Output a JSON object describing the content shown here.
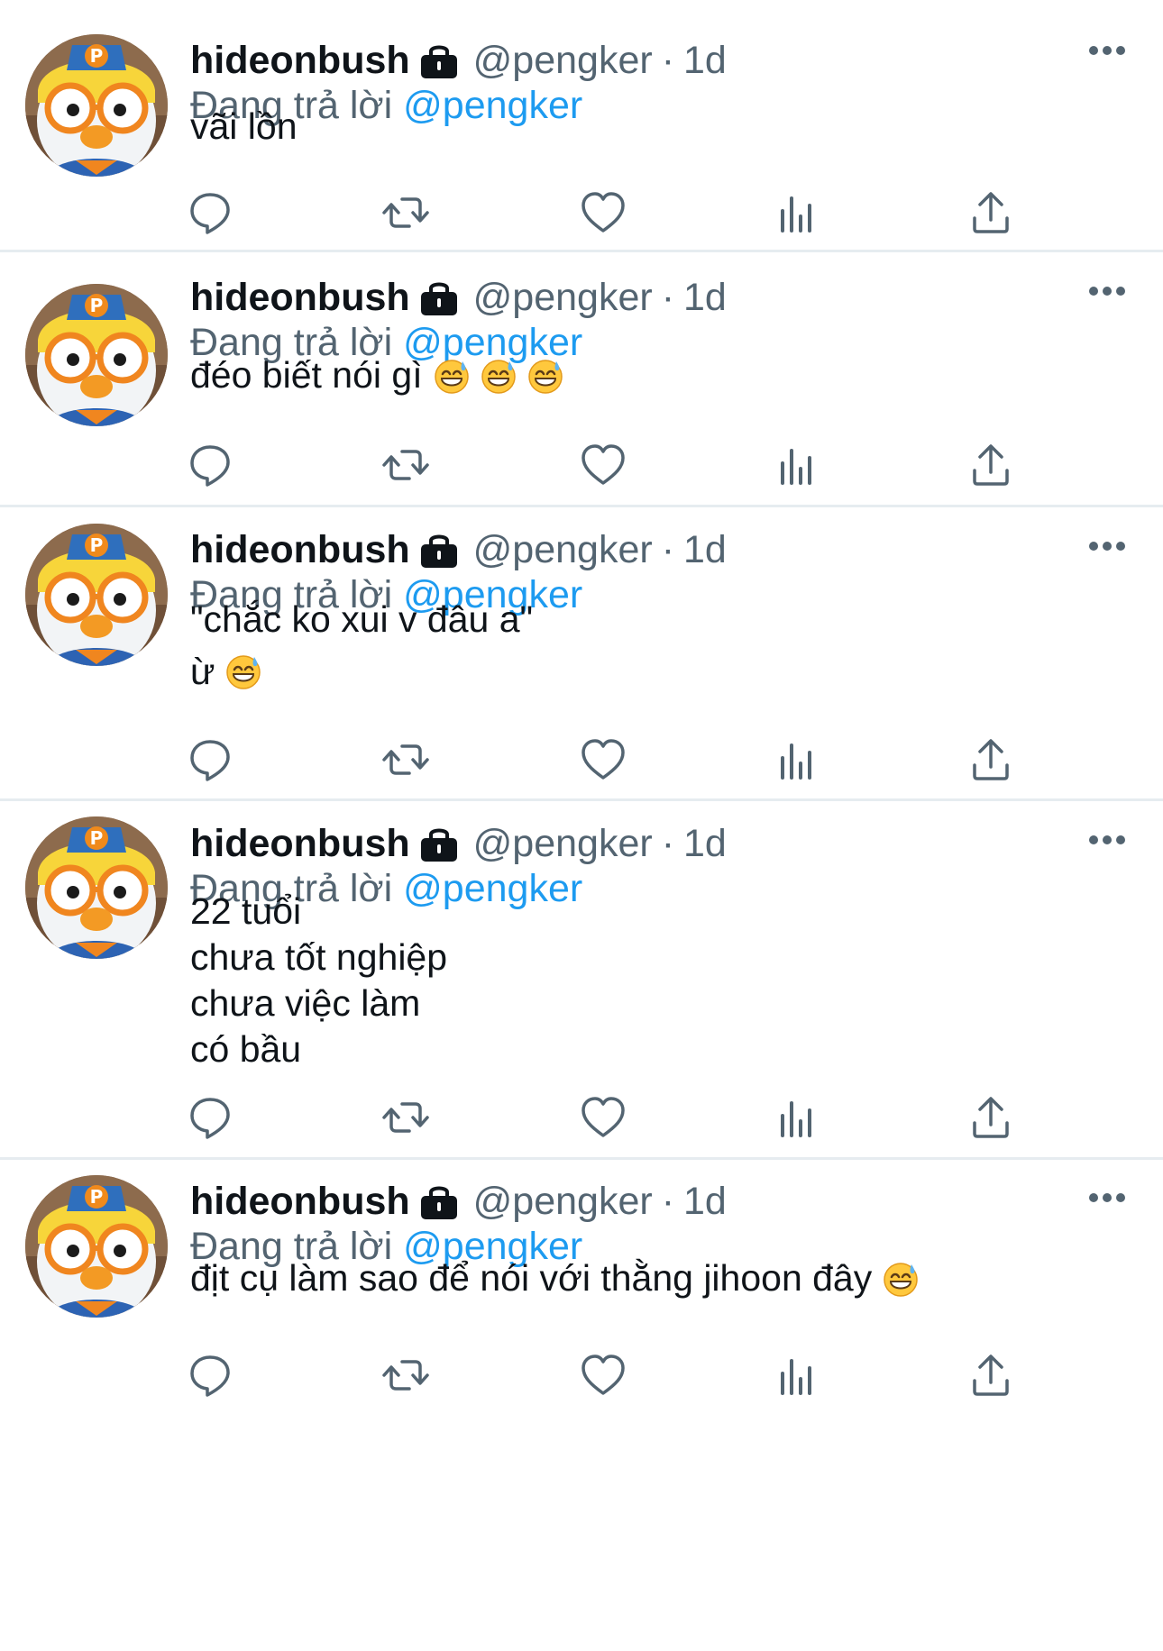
{
  "user": {
    "display_name": "hideonbush",
    "handle": "@pengker",
    "separator": "·",
    "time": "1d",
    "reply_prefix": "Đang trả lời",
    "reply_to": "@pengker"
  },
  "icons": {
    "lock": "lock-icon",
    "more": "more-options-icon",
    "reply": "reply-bubble-icon",
    "retweet": "retweet-icon",
    "like": "heart-icon",
    "views": "views-bar-chart-icon",
    "share": "share-upload-icon",
    "emoji": "grinning-face-with-sweat-emoji"
  },
  "colors": {
    "text": "#0f1419",
    "secondary": "#536471",
    "link": "#1d9bf0",
    "divider": "#e6ecf0"
  },
  "tweets": [
    {
      "lines": [
        "vãi lồn"
      ],
      "line_emoji_counts": [
        0
      ]
    },
    {
      "lines": [
        "đéo biết nói gì"
      ],
      "line_emoji_counts": [
        3
      ]
    },
    {
      "lines": [
        "\"chắc ko xui v đâu a\"",
        "ừ"
      ],
      "line_emoji_counts": [
        0,
        1
      ]
    },
    {
      "lines": [
        "22 tuổi",
        "chưa tốt nghiệp",
        "chưa việc làm",
        "có bầu"
      ],
      "line_emoji_counts": [
        0,
        0,
        0,
        0
      ]
    },
    {
      "lines": [
        "địt cụ làm sao để nói với thằng jihoon đây"
      ],
      "line_emoji_counts": [
        1
      ]
    }
  ]
}
